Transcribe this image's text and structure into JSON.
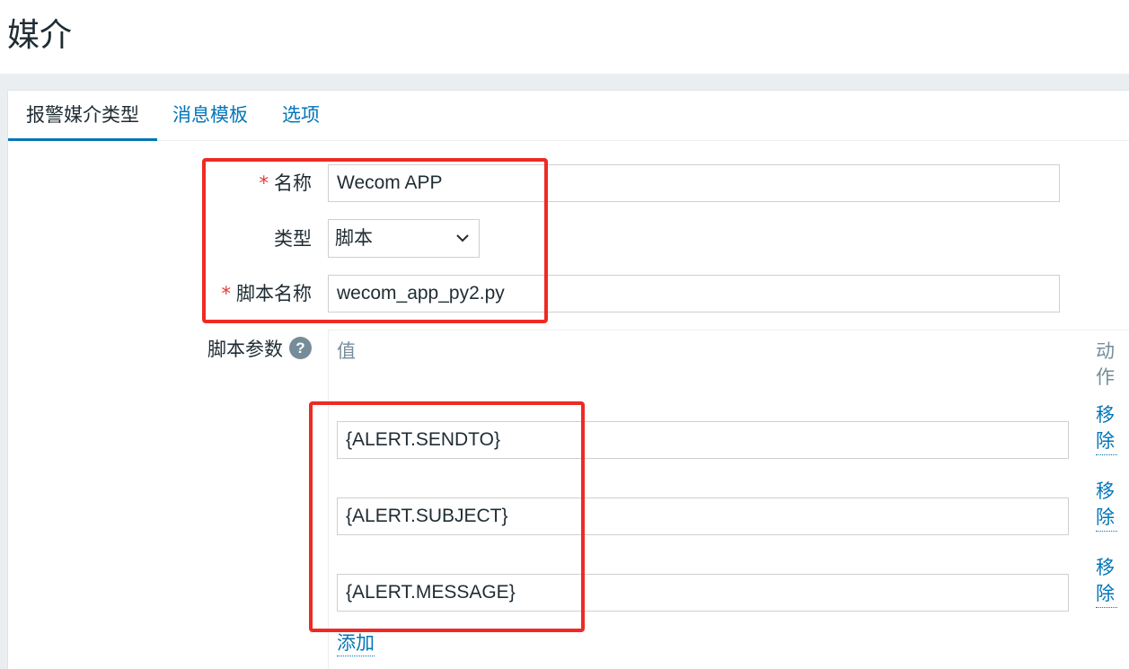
{
  "page": {
    "title": "媒介"
  },
  "tabs": [
    {
      "label": "报警媒介类型",
      "active": true
    },
    {
      "label": "消息模板",
      "active": false
    },
    {
      "label": "选项",
      "active": false
    }
  ],
  "form": {
    "required_marker": "*",
    "name_label": "名称",
    "name_value": "Wecom APP",
    "type_label": "类型",
    "type_value": "脚本",
    "script_name_label": "脚本名称",
    "script_name_value": "wecom_app_py2.py",
    "params_label": "脚本参数",
    "help_icon": "?"
  },
  "params": {
    "header_value": "值",
    "header_action": "动作",
    "rows": [
      {
        "value": "{ALERT.SENDTO}",
        "remove_label": "移除"
      },
      {
        "value": "{ALERT.SUBJECT}",
        "remove_label": "移除"
      },
      {
        "value": "{ALERT.MESSAGE}",
        "remove_label": "移除"
      }
    ],
    "add_label": "添加"
  },
  "colors": {
    "accent": "#0275b8",
    "required": "#e33734",
    "annotation": "#ee2a24"
  }
}
